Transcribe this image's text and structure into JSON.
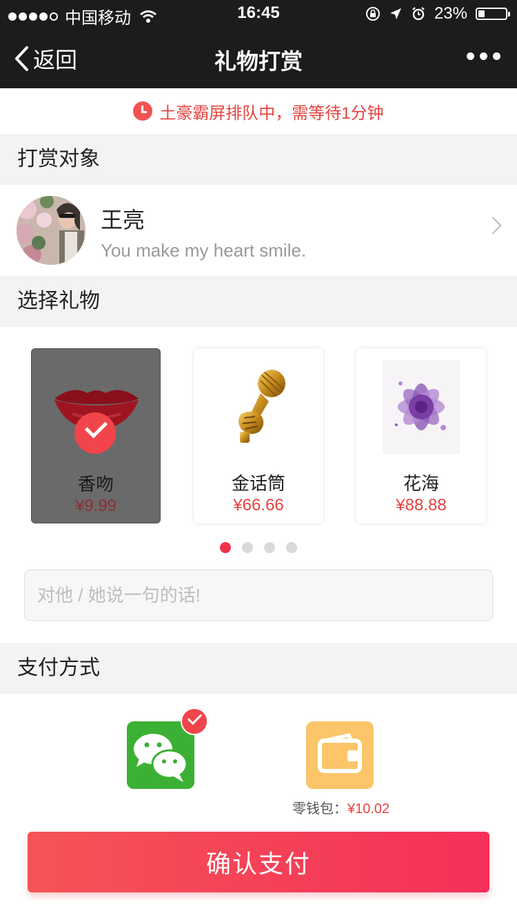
{
  "status_bar": {
    "carrier": "中国移动",
    "time": "16:45",
    "battery": "23%",
    "battery_level": 0.23,
    "icons": [
      "wifi-icon",
      "orientation-lock-icon",
      "location-icon",
      "alarm-icon"
    ]
  },
  "nav": {
    "back_label": "返回",
    "title": "礼物打赏"
  },
  "notice": {
    "text": "土豪霸屏排队中，需等待1分钟",
    "color": "#e64340"
  },
  "sections": {
    "recipient_title": "打赏对象",
    "gift_title": "选择礼物",
    "payment_title": "支付方式"
  },
  "recipient": {
    "name": "王亮",
    "signature": "You make my heart smile."
  },
  "gifts": [
    {
      "name": "香吻",
      "price": "¥9.99",
      "icon": "lips-icon",
      "selected": true
    },
    {
      "name": "金话筒",
      "price": "¥66.66",
      "icon": "golden-microphone-icon",
      "selected": false
    },
    {
      "name": "花海",
      "price": "¥88.88",
      "icon": "purple-flower-icon",
      "selected": false
    }
  ],
  "pager": {
    "pages": 4,
    "current": 1
  },
  "message": {
    "placeholder": "对他 / 她说一句的话!",
    "value": ""
  },
  "payment": {
    "methods": [
      {
        "icon": "wechat-icon",
        "selected": true,
        "color": "#3cb034"
      },
      {
        "icon": "wallet-icon",
        "selected": false,
        "color": "#fcc56a"
      }
    ],
    "wallet_label": "零钱包：",
    "wallet_amount": "¥10.02"
  },
  "confirm_label": "确认支付",
  "colors": {
    "accent": "#f0304b",
    "nav_bg": "#1c1c1e",
    "section_bg": "#f3f3f3"
  }
}
